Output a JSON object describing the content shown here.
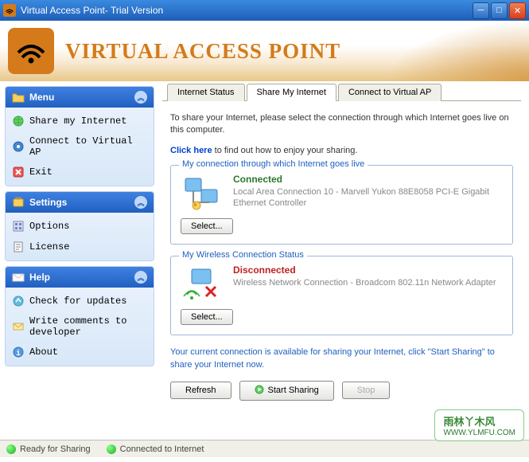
{
  "window": {
    "title": "Virtual Access Point- Trial Version"
  },
  "header": {
    "title": "VIRTUAL ACCESS POINT"
  },
  "sidebar": {
    "menu": {
      "title": "Menu",
      "items": [
        {
          "label": "Share my Internet"
        },
        {
          "label": "Connect to Virtual AP"
        },
        {
          "label": "Exit"
        }
      ]
    },
    "settings": {
      "title": "Settings",
      "items": [
        {
          "label": "Options"
        },
        {
          "label": "License"
        }
      ]
    },
    "help": {
      "title": "Help",
      "items": [
        {
          "label": "Check for updates"
        },
        {
          "label": "Write comments to developer"
        },
        {
          "label": "About"
        }
      ]
    }
  },
  "tabs": [
    {
      "label": "Internet Status"
    },
    {
      "label": "Share My Internet"
    },
    {
      "label": "Connect to Virtual AP"
    }
  ],
  "content": {
    "intro": "To share your Internet, please select the connection through which Internet goes live on this computer.",
    "click_here": "Click here",
    "click_here_rest": " to find out how to enjoy your sharing.",
    "conn1": {
      "legend": "My connection  through which Internet goes live",
      "status": "Connected",
      "desc": "Local Area Connection 10 - Marvell Yukon 88E8058 PCI-E Gigabit Ethernet Controller",
      "select": "Select..."
    },
    "conn2": {
      "legend": "My Wireless Connection Status",
      "status": "Disconnected",
      "desc": "Wireless Network Connection - Broadcom 802.11n Network Adapter",
      "select": "Select..."
    },
    "footer_note": "Your current connection is available for sharing your Internet, click \"Start Sharing\" to share your Internet now.",
    "refresh": "Refresh",
    "start": "Start Sharing",
    "stop": "Stop"
  },
  "statusbar": {
    "ready": "Ready for Sharing",
    "connected": "Connected to Internet"
  },
  "watermark": {
    "main": "雨林丫木风",
    "url": "WWW.YLMFU.COM"
  }
}
